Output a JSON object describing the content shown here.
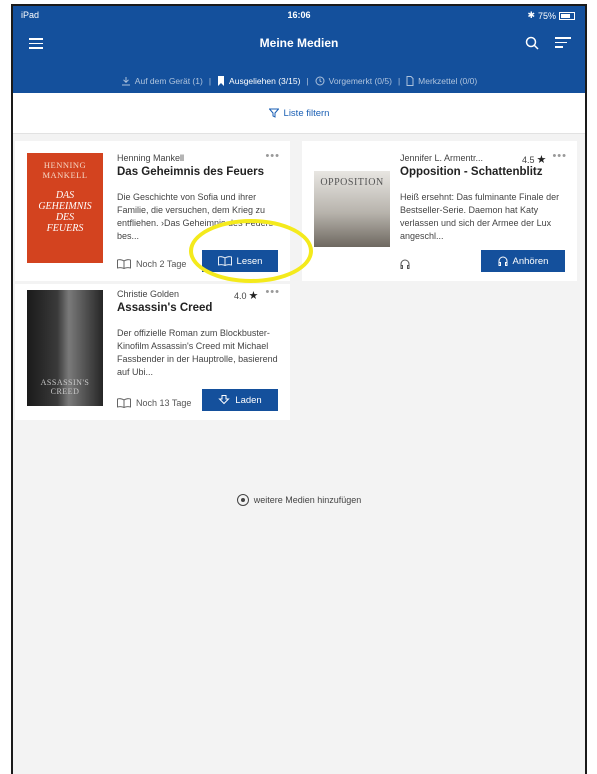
{
  "status_bar": {
    "device": "iPad",
    "time": "16:06",
    "battery": "75%"
  },
  "header": {
    "title": "Meine Medien"
  },
  "tabs": [
    {
      "label": "Auf dem Gerät (1)",
      "icon": "download-icon"
    },
    {
      "label": "Ausgeliehen (3/15)",
      "icon": "bookmark-icon"
    },
    {
      "label": "Vorgemerkt (0/5)",
      "icon": "clock-icon"
    },
    {
      "label": "Merkzettel (0/0)",
      "icon": "document-icon"
    }
  ],
  "filter": {
    "label": "Liste filtern"
  },
  "books": [
    {
      "author": "Henning Mankell",
      "title": "Das Geheimnis des Feuers",
      "description": "Die Geschichte von Sofia und ihrer Familie, die versuchen, dem Krieg zu entfliehen. ›Das Geheimnis des Feuers‹ bes...",
      "loan": "Noch 2 Tage",
      "action": "Lesen",
      "cover_text": "HENNING MANKELL",
      "cover_title": "DAS GEHEIMNIS DES FEUERS"
    },
    {
      "author": "Jennifer L. Armentr...",
      "rating": "4.5",
      "title": "Opposition - Schattenblitz",
      "description": "Heiß ersehnt: Das fulminante Finale der Bestseller-Serie. Daemon hat Katy verlassen und sich der Armee der Lux angeschl...",
      "action": "Anhören",
      "cover_text": "OPPOSITION"
    },
    {
      "author": "Christie Golden",
      "rating": "4.0",
      "title": "Assassin's Creed",
      "description": "Der offizielle Roman zum Blockbuster-Kinofilm Assassin's Creed mit Michael Fassbender in der Hauptrolle, basierend auf Ubi...",
      "loan": "Noch 13 Tage",
      "action": "Laden",
      "cover_text": "ASSASSIN'S CREED"
    }
  ],
  "add_more": {
    "label": "weitere Medien hinzufügen"
  },
  "colors": {
    "brand": "#14509c",
    "highlight": "#f4ea1c"
  }
}
